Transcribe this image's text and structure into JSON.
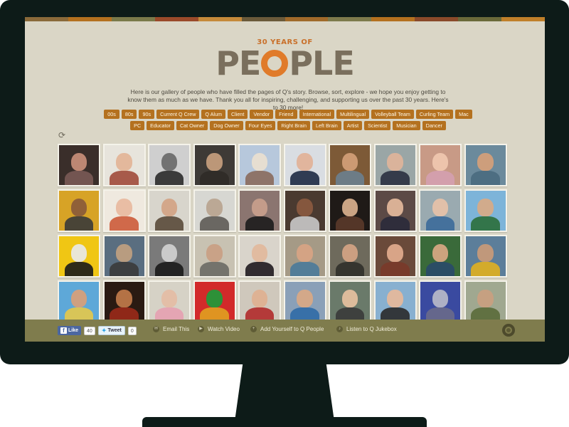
{
  "logo": {
    "top": "30 YEARS OF",
    "left": "PE",
    "right": "PLE"
  },
  "intro": "Here is our gallery of people who have filled the pages of Q's story. Browse, sort, explore - we hope you enjoy getting to know them as much as we have. Thank you all for inspiring, challenging, and supporting us over the past 30 years. Here's to 30 more!",
  "tags": [
    "00s",
    "80s",
    "90s",
    "Current Q Crew",
    "Q Alum",
    "Client",
    "Vendor",
    "Friend",
    "International",
    "Multilingual",
    "Volleyball Team",
    "Curling Team",
    "Mac",
    "PC",
    "Educator",
    "Cat Owner",
    "Dog Owner",
    "Four Eyes",
    "Right Brain",
    "Left Brain",
    "Artist",
    "Scientist",
    "Musician",
    "Dancer"
  ],
  "refresh_icon": "refresh-icon",
  "photos": [
    {
      "name": "portrait-01",
      "bg": "#3a2e2a",
      "skin": "#c98f7a",
      "shirt": "#7a5a55"
    },
    {
      "name": "portrait-02",
      "bg": "#e7e4dc",
      "skin": "#e3b496",
      "shirt": "#a04a3a"
    },
    {
      "name": "portrait-03",
      "bg": "#cfcfcf",
      "skin": "#6a6a6a",
      "shirt": "#2a2a2a"
    },
    {
      "name": "portrait-04",
      "bg": "#3e3a36",
      "skin": "#c7a07e",
      "shirt": "#2f2b27"
    },
    {
      "name": "portrait-05",
      "bg": "#b7c8dc",
      "skin": "#e9dfcf",
      "shirt": "#8a6a5c"
    },
    {
      "name": "portrait-06",
      "bg": "#d9dde2",
      "skin": "#e2b197",
      "shirt": "#1d2a44"
    },
    {
      "name": "portrait-07",
      "bg": "#7d5a37",
      "skin": "#d2a078",
      "shirt": "#6c7f8f"
    },
    {
      "name": "portrait-08",
      "bg": "#9aa6a6",
      "skin": "#e0b49a",
      "shirt": "#2a3040"
    },
    {
      "name": "portrait-09",
      "bg": "#c89a86",
      "skin": "#f0c8b0",
      "shirt": "#d4a0b0"
    },
    {
      "name": "portrait-10",
      "bg": "#6b8a9c",
      "skin": "#d6a07a",
      "shirt": "#4a6a80"
    },
    {
      "name": "portrait-11",
      "bg": "#d7a326",
      "skin": "#8a5a3a",
      "shirt": "#3a3a3a"
    },
    {
      "name": "portrait-12",
      "bg": "#efe9df",
      "skin": "#e8b99e",
      "shirt": "#cc5b3a"
    },
    {
      "name": "portrait-13",
      "bg": "#d8d5cc",
      "skin": "#d2a384",
      "shirt": "#5a4a3a"
    },
    {
      "name": "portrait-14",
      "bg": "#d7d7d2",
      "skin": "#b9a48f",
      "shirt": "#5e5b55"
    },
    {
      "name": "portrait-15",
      "bg": "#8b7570",
      "skin": "#c99f8c",
      "shirt": "#1c1c1c"
    },
    {
      "name": "portrait-16",
      "bg": "#4a3a30",
      "skin": "#8a5a40",
      "shirt": "#c9c9c9"
    },
    {
      "name": "portrait-17",
      "bg": "#1f1a17",
      "skin": "#d9b08e",
      "shirt": "#5a3a2a"
    },
    {
      "name": "portrait-18",
      "bg": "#5c4a46",
      "skin": "#e4b89c",
      "shirt": "#2a2a3a"
    },
    {
      "name": "portrait-19",
      "bg": "#9aaab0",
      "skin": "#e7c2a8",
      "shirt": "#3c6a9a"
    },
    {
      "name": "portrait-20",
      "bg": "#7db4d9",
      "skin": "#d8aa86",
      "shirt": "#2b6e3a"
    },
    {
      "name": "portrait-21",
      "bg": "#f0c614",
      "skin": "#e8e8e8",
      "shirt": "#1a1a1a"
    },
    {
      "name": "portrait-22",
      "bg": "#5a6e80",
      "skin": "#c0a080",
      "shirt": "#3a3a3a"
    },
    {
      "name": "portrait-23",
      "bg": "#7a7a7a",
      "skin": "#d0d0d0",
      "shirt": "#1a1a1a"
    },
    {
      "name": "portrait-24",
      "bg": "#c8c2b2",
      "skin": "#c9a083",
      "shirt": "#6a6a64"
    },
    {
      "name": "portrait-25",
      "bg": "#d9d4cb",
      "skin": "#e2b89c",
      "shirt": "#1f1a1f"
    },
    {
      "name": "portrait-26",
      "bg": "#a59a86",
      "skin": "#d8a484",
      "shirt": "#4a7a9a"
    },
    {
      "name": "portrait-27",
      "bg": "#6e6a5c",
      "skin": "#d4a484",
      "shirt": "#30302a"
    },
    {
      "name": "portrait-28",
      "bg": "#6a4a3a",
      "skin": "#e2ab8e",
      "shirt": "#7a3a2a"
    },
    {
      "name": "portrait-29",
      "bg": "#3a6a3a",
      "skin": "#d9a884",
      "shirt": "#2a4a6a"
    },
    {
      "name": "portrait-30",
      "bg": "#5c7e9a",
      "skin": "#c99a78",
      "shirt": "#e0b020"
    },
    {
      "name": "portrait-31",
      "bg": "#5ea8d8",
      "skin": "#d9a078",
      "shirt": "#e6c84a"
    },
    {
      "name": "portrait-32",
      "bg": "#2a1a12",
      "skin": "#c07a4a",
      "shirt": "#9a2a1a"
    },
    {
      "name": "portrait-33",
      "bg": "#d6d2c6",
      "skin": "#e4bca4",
      "shirt": "#e6a0b0"
    },
    {
      "name": "portrait-34",
      "bg": "#d22a2a",
      "skin": "#1e9a3a",
      "shirt": "#e0a020"
    },
    {
      "name": "portrait-35",
      "bg": "#cfc8bc",
      "skin": "#e0b090",
      "shirt": "#b02a2a"
    },
    {
      "name": "portrait-36",
      "bg": "#8aa0b8",
      "skin": "#d9a884",
      "shirt": "#2f6aa6"
    },
    {
      "name": "portrait-37",
      "bg": "#6a7a6a",
      "skin": "#e6c0a0",
      "shirt": "#3a3a3a"
    },
    {
      "name": "portrait-38",
      "bg": "#88b0d0",
      "skin": "#e6b89a",
      "shirt": "#2a2a2a"
    },
    {
      "name": "portrait-39",
      "bg": "#3a4aa0",
      "skin": "#b8b8c8",
      "shirt": "#6a6a8a"
    },
    {
      "name": "portrait-40",
      "bg": "#a0a890",
      "skin": "#c9a080",
      "shirt": "#5a6a3a"
    }
  ],
  "bottom_bar": {
    "fb_like": "Like",
    "fb_count": "40",
    "tweet": "Tweet",
    "tweet_count": "0",
    "email": "Email This",
    "video": "Watch Video",
    "add": "Add Yourself to Q People",
    "jukebox": "Listen to Q Jukebox"
  },
  "colors": {
    "background": "#dad6c6",
    "tag": "#b4711f",
    "logo_text": "#7a6f5d",
    "logo_o": "#e07b2a",
    "bottom_bar": "#7f7c4d",
    "monitor": "#0d1b18"
  },
  "top_stripe": [
    "#8a6a3a",
    "#b4711f",
    "#7a7a4a",
    "#9a4a2a",
    "#c58a3a",
    "#6a5a3a",
    "#a06a2a",
    "#7d7b4c",
    "#b4711f",
    "#8a4a2a",
    "#6a6a3a",
    "#c0802a"
  ]
}
